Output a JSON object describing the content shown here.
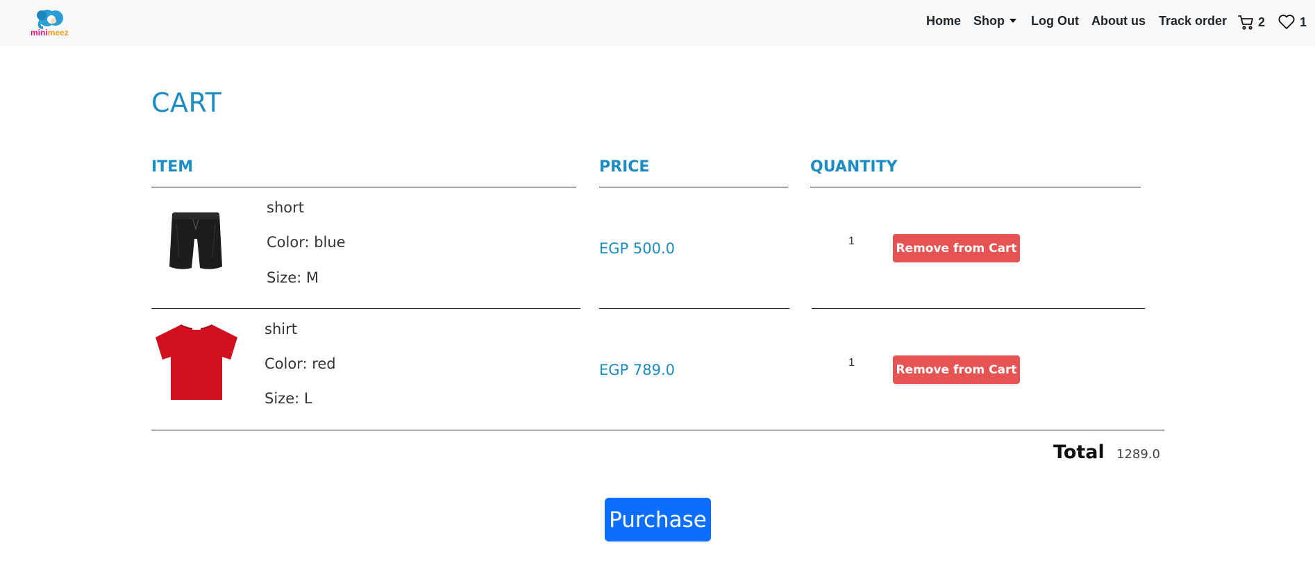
{
  "brand": {
    "name_part1": "mini",
    "name_part2": "meez"
  },
  "nav": {
    "home": "Home",
    "shop": "Shop",
    "logout": "Log Out",
    "about": "About us",
    "track": "Track order",
    "cart_count": "2",
    "wishlist_count": "1"
  },
  "cart": {
    "title": "CART",
    "headers": {
      "item": "ITEM",
      "price": "PRICE",
      "quantity": "QUANTITY"
    },
    "items": [
      {
        "name": "short",
        "color": "Color: blue",
        "size": "Size: M",
        "price": "EGP 500.0",
        "quantity": "1",
        "remove_label": "Remove from Cart",
        "image": "black-shorts-image"
      },
      {
        "name": "shirt",
        "color": "Color: red",
        "size": "Size: L",
        "price": "EGP 789.0",
        "quantity": "1",
        "remove_label": "Remove from Cart",
        "image": "red-tshirt-image"
      }
    ],
    "total_label": "Total",
    "total_value": "1289.0",
    "purchase_label": "Purchase"
  },
  "colors": {
    "accent": "#1b8cc4",
    "danger": "#e55353",
    "primary": "#0d6efd",
    "navbar_bg": "#f8f9fa"
  },
  "icons": {
    "cart": "cart-icon",
    "wishlist": "heart-icon"
  }
}
